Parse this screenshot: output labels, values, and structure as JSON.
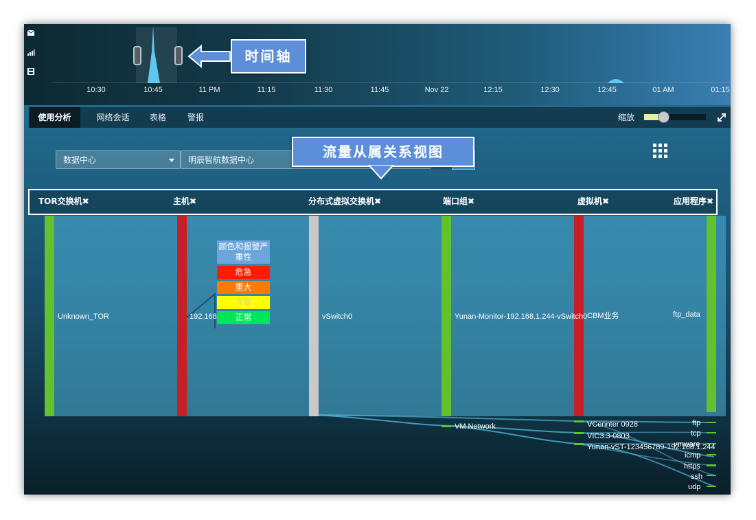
{
  "timeline": {
    "ticks": [
      "10:30",
      "10:45",
      "11 PM",
      "11:15",
      "11:30",
      "11:45",
      "Nov 22",
      "12:15",
      "12:30",
      "12:45",
      "01 AM",
      "01:15"
    ],
    "side_icons": [
      "mail-icon",
      "signal-icon",
      "save-icon"
    ]
  },
  "callouts": {
    "timeline": "时间轴",
    "view": "流量从属关系视图"
  },
  "tabs": [
    {
      "label": "使用分析",
      "active": true
    },
    {
      "label": "网络会话",
      "active": false
    },
    {
      "label": "表格",
      "active": false
    },
    {
      "label": "警报",
      "active": false
    }
  ],
  "zoom": {
    "label": "缩放",
    "value": 0.31
  },
  "filters": {
    "category": "数据中心",
    "datacenter": "明辰智航数据中心"
  },
  "columns": [
    "TOR交换机",
    "主机",
    "分布式虚拟交换机",
    "端口组",
    "虚拟机",
    "应用程序"
  ],
  "close_glyph": "✖",
  "nodes": {
    "tor": "Unknown_TOR",
    "host": "192.168",
    "vswitch": "vSwitch0",
    "portgroup_main": "Yunan-Monitor-192.168.1.244-vSwitch0",
    "portgroup_vm": "VM Network",
    "vm_main": "CBM业务",
    "vm_small": [
      "VCennter 0928",
      "VIC3.3-0803",
      "Yunan-vST-123456789-192.168.1.244"
    ],
    "app_main": "ftp_data",
    "app_small": [
      "ftp",
      "tcp",
      "vmware",
      "icmp",
      "https",
      "ssh",
      "udp"
    ]
  },
  "legend": {
    "title": "颜色和报警严重性",
    "items": [
      {
        "label": "危急",
        "color": "#ff1a00"
      },
      {
        "label": "重大",
        "color": "#ff7a00"
      },
      {
        "label": "次要",
        "color": "#ffff00"
      },
      {
        "label": "正常",
        "color": "#00e65c"
      }
    ]
  },
  "colors": {
    "normal": "#62c22d",
    "critical": "#c62026",
    "neutral": "#c9c9c9",
    "flow": "#4fb3d8"
  }
}
